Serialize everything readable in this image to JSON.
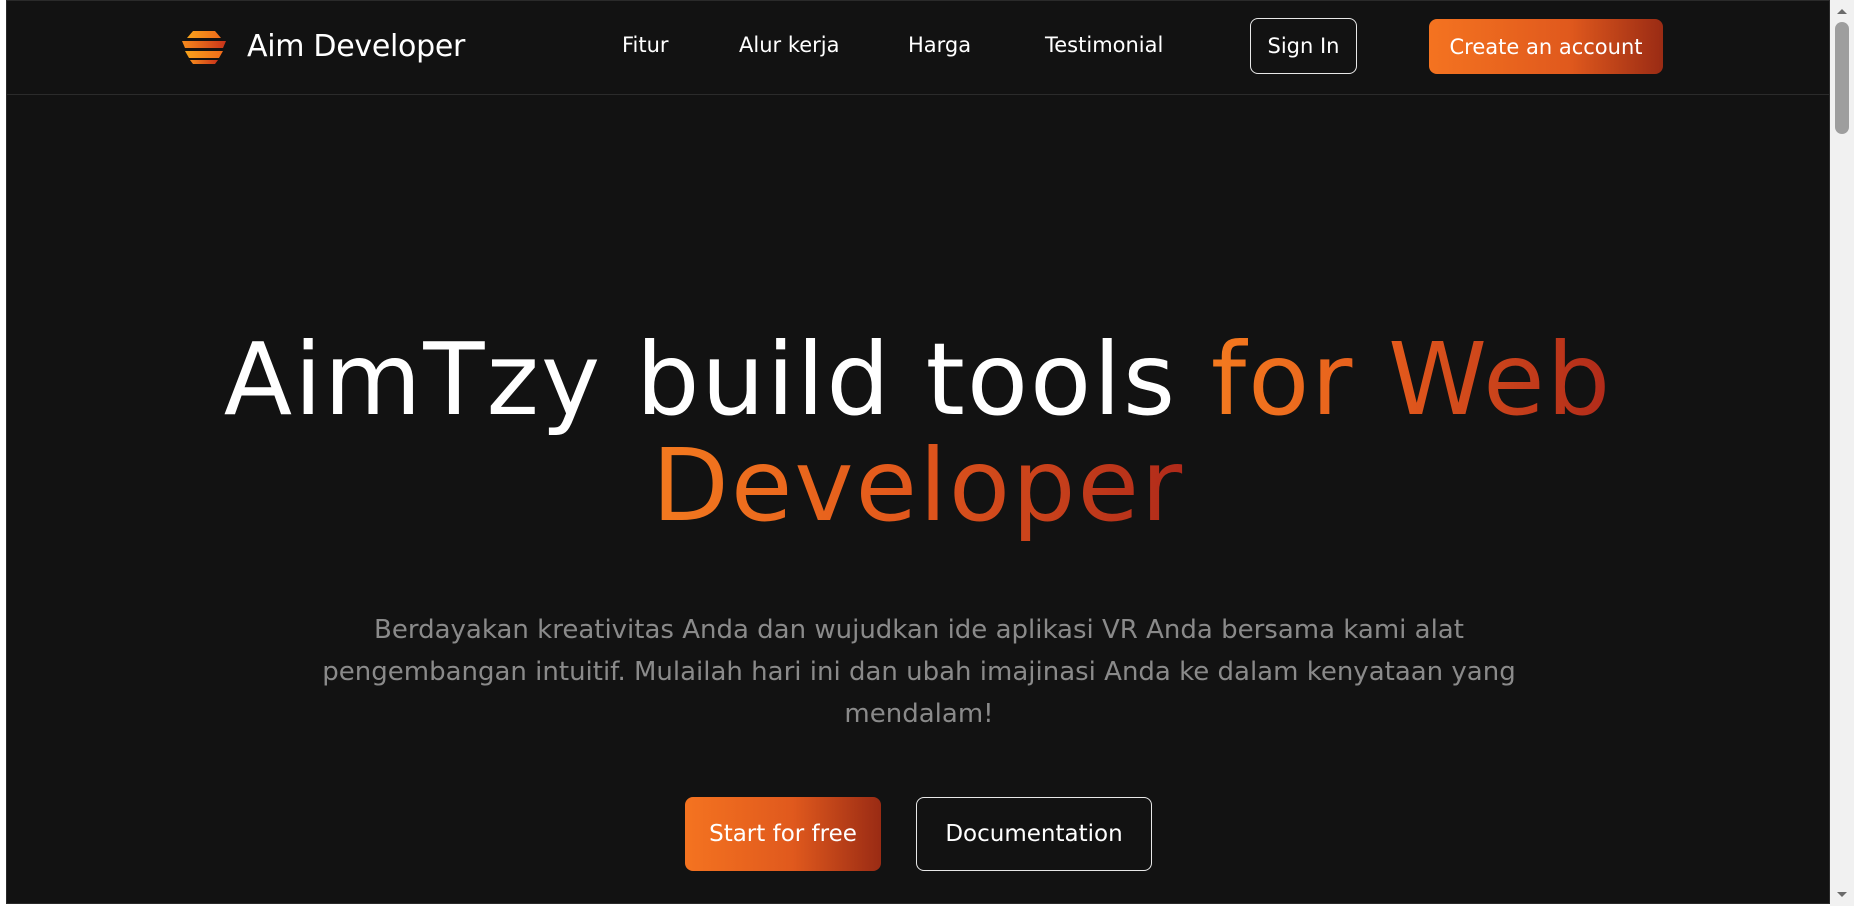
{
  "brand": {
    "name": "Aim Developer",
    "logo_icon": "stacked-layers-logo-icon"
  },
  "nav": {
    "items": [
      "Fitur",
      "Alur kerja",
      "Harga",
      "Testimonial"
    ]
  },
  "header_actions": {
    "signin_label": "Sign In",
    "create_label": "Create an account"
  },
  "hero": {
    "title_plain": "AimTzy build tools ",
    "title_accent_1": "for Web",
    "title_accent_2": "Developer",
    "subtitle": "Berdayakan kreativitas Anda dan wujudkan ide aplikasi VR Anda bersama kami alat pengembangan intuitif. Mulailah hari ini dan ubah imajinasi Anda ke dalam kenyataan yang mendalam!",
    "primary_cta": "Start for free",
    "secondary_cta": "Documentation"
  },
  "colors": {
    "background": "#121212",
    "accent_start": "#f47320",
    "accent_end": "#9a2b14",
    "muted_text": "#8a8a8a"
  },
  "scrollbar": {
    "up_icon": "scroll-up-arrow-icon",
    "down_icon": "scroll-down-arrow-icon"
  }
}
